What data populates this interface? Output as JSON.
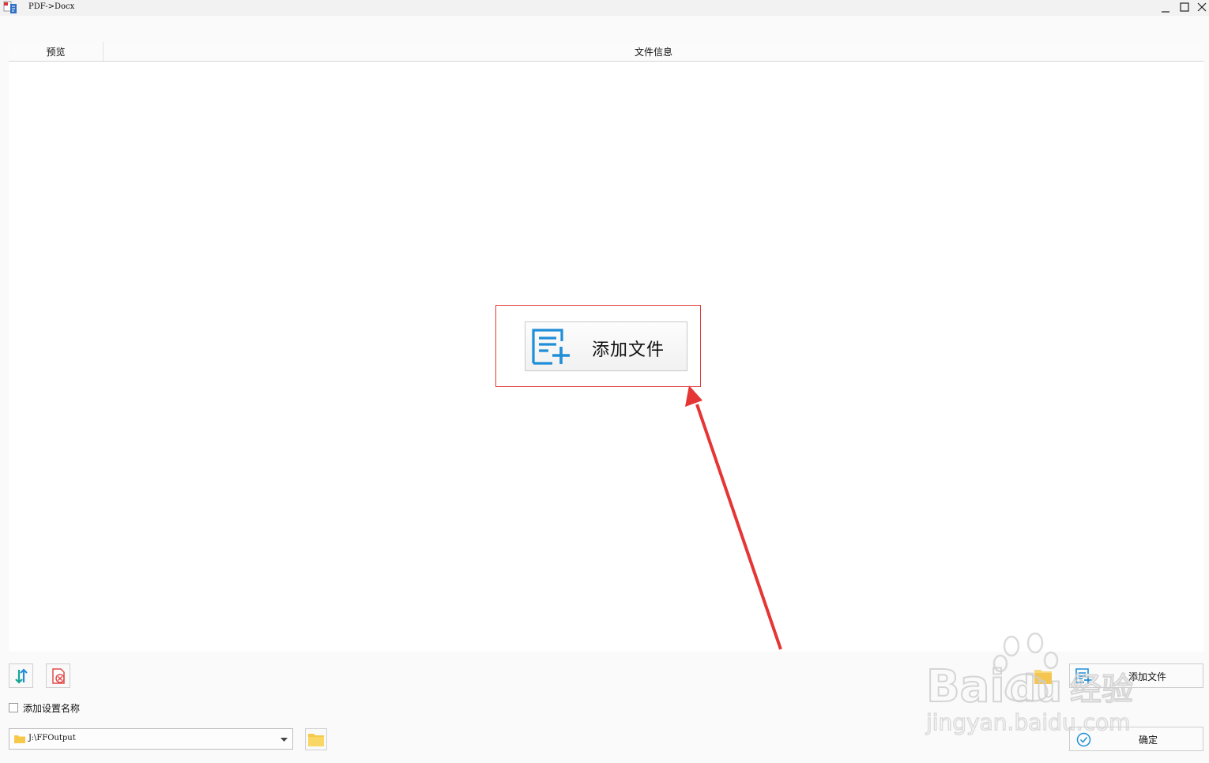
{
  "window": {
    "title": "PDF->Docx",
    "controls": [
      "minimize-icon",
      "maximize-icon",
      "close-icon"
    ]
  },
  "list": {
    "columns": [
      "预览",
      "文件信息"
    ],
    "empty_action_label": "添加文件"
  },
  "toolbar": {
    "icons": [
      "sort-icon",
      "clear-list-icon"
    ]
  },
  "options": {
    "add_setting_name_label": "添加设置名称",
    "add_setting_name_checked": false
  },
  "output": {
    "path": "J:\\FFOutput",
    "browse_icon": "folder-icon"
  },
  "actions": {
    "add_file_label": "添加文件",
    "ok_label": "确定"
  },
  "watermark": {
    "brand_text": "Bai du 经验",
    "url_text": "jingyan.baidu.com"
  },
  "colors": {
    "accent_blue": "#1f8ed8",
    "highlight_red": "#e03a3a",
    "folder_yellow": "#f6c94a",
    "teal": "#17a596"
  }
}
